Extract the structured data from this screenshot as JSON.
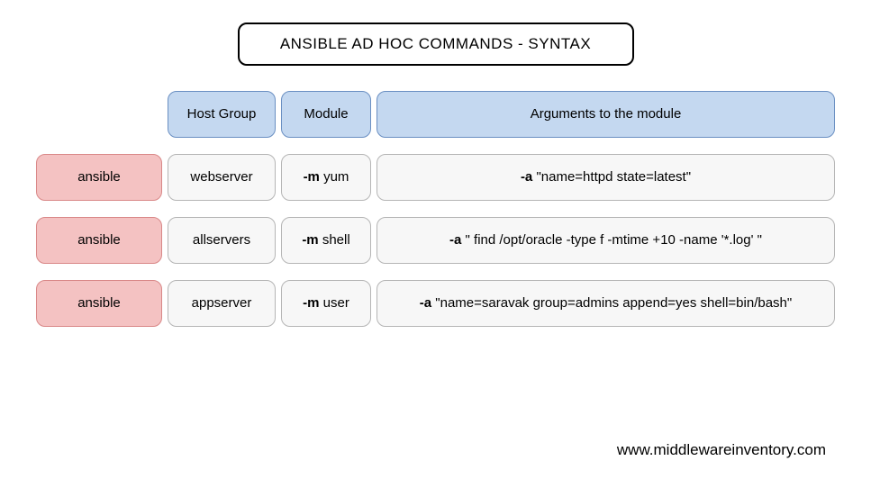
{
  "title": "ANSIBLE AD HOC COMMANDS - SYNTAX",
  "headers": {
    "host": "Host Group",
    "module": "Module",
    "args": "Arguments to the module"
  },
  "command_label": "ansible",
  "flag_module": "-m",
  "flag_args": "-a",
  "rows": [
    {
      "host": "webserver",
      "module": "yum",
      "args": "\"name=httpd state=latest\""
    },
    {
      "host": "allservers",
      "module": "shell",
      "args": "\" find /opt/oracle -type f -mtime +10 -name '*.log' \""
    },
    {
      "host": "appserver",
      "module": "user",
      "args": "\"name=saravak group=admins append=yes shell=bin/bash\""
    }
  ],
  "footer": "www.middlewareinventory.com"
}
